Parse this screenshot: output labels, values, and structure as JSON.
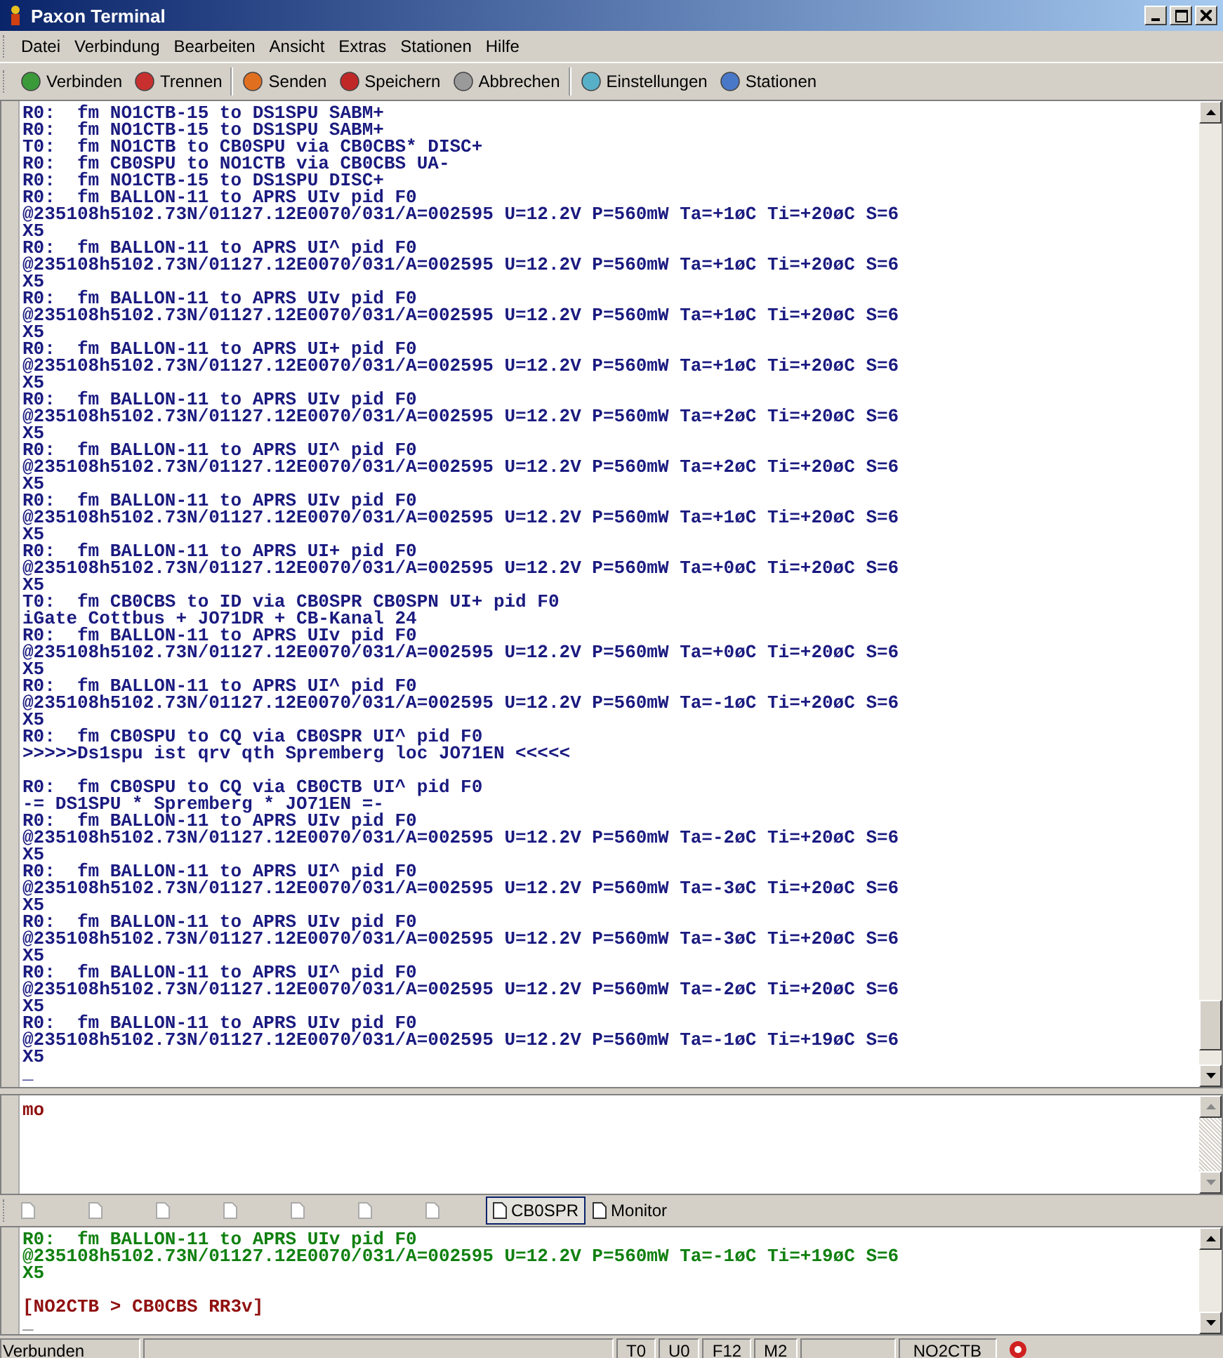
{
  "window": {
    "title": "Paxon Terminal"
  },
  "menu": [
    "Datei",
    "Verbindung",
    "Bearbeiten",
    "Ansicht",
    "Extras",
    "Stationen",
    "Hilfe"
  ],
  "toolbar": [
    {
      "label": "Verbinden",
      "kind": "connect",
      "group_start": false
    },
    {
      "label": "Trennen",
      "kind": "disconnect",
      "group_start": false
    },
    {
      "label": "Senden",
      "kind": "send",
      "group_start": true
    },
    {
      "label": "Speichern",
      "kind": "save",
      "group_start": false
    },
    {
      "label": "Abbrechen",
      "kind": "cancel",
      "group_start": false
    },
    {
      "label": "Einstellungen",
      "kind": "settings",
      "group_start": true
    },
    {
      "label": "Stationen",
      "kind": "stations",
      "group_start": false
    }
  ],
  "monitor": {
    "lines": [
      {
        "kind": "rx",
        "text": "R0:  fm NO1CTB-15 to DS1SPU SABM+"
      },
      {
        "kind": "rx",
        "text": "R0:  fm NO1CTB-15 to DS1SPU SABM+"
      },
      {
        "kind": "rx",
        "text": "T0:  fm NO1CTB to CB0SPU via CB0CBS* DISC+"
      },
      {
        "kind": "rx",
        "text": "R0:  fm CB0SPU to NO1CTB via CB0CBS UA-"
      },
      {
        "kind": "rx",
        "text": "R0:  fm NO1CTB-15 to DS1SPU DISC+"
      },
      {
        "kind": "rx",
        "text": "R0:  fm BALLON-11 to APRS UIv pid F0"
      },
      {
        "kind": "rx",
        "text": "@235108h5102.73N/01127.12E0070/031/A=002595 U=12.2V P=560mW Ta=+1øC Ti=+20øC S=6"
      },
      {
        "kind": "rx",
        "text": "X5"
      },
      {
        "kind": "rx",
        "text": "R0:  fm BALLON-11 to APRS UI^ pid F0"
      },
      {
        "kind": "rx",
        "text": "@235108h5102.73N/01127.12E0070/031/A=002595 U=12.2V P=560mW Ta=+1øC Ti=+20øC S=6"
      },
      {
        "kind": "rx",
        "text": "X5"
      },
      {
        "kind": "rx",
        "text": "R0:  fm BALLON-11 to APRS UIv pid F0"
      },
      {
        "kind": "rx",
        "text": "@235108h5102.73N/01127.12E0070/031/A=002595 U=12.2V P=560mW Ta=+1øC Ti=+20øC S=6"
      },
      {
        "kind": "rx",
        "text": "X5"
      },
      {
        "kind": "rx",
        "text": "R0:  fm BALLON-11 to APRS UI+ pid F0"
      },
      {
        "kind": "rx",
        "text": "@235108h5102.73N/01127.12E0070/031/A=002595 U=12.2V P=560mW Ta=+1øC Ti=+20øC S=6"
      },
      {
        "kind": "rx",
        "text": "X5"
      },
      {
        "kind": "rx",
        "text": "R0:  fm BALLON-11 to APRS UIv pid F0"
      },
      {
        "kind": "rx",
        "text": "@235108h5102.73N/01127.12E0070/031/A=002595 U=12.2V P=560mW Ta=+2øC Ti=+20øC S=6"
      },
      {
        "kind": "rx",
        "text": "X5"
      },
      {
        "kind": "rx",
        "text": "R0:  fm BALLON-11 to APRS UI^ pid F0"
      },
      {
        "kind": "rx",
        "text": "@235108h5102.73N/01127.12E0070/031/A=002595 U=12.2V P=560mW Ta=+2øC Ti=+20øC S=6"
      },
      {
        "kind": "rx",
        "text": "X5"
      },
      {
        "kind": "rx",
        "text": "R0:  fm BALLON-11 to APRS UIv pid F0"
      },
      {
        "kind": "rx",
        "text": "@235108h5102.73N/01127.12E0070/031/A=002595 U=12.2V P=560mW Ta=+1øC Ti=+20øC S=6"
      },
      {
        "kind": "rx",
        "text": "X5"
      },
      {
        "kind": "rx",
        "text": "R0:  fm BALLON-11 to APRS UI+ pid F0"
      },
      {
        "kind": "rx",
        "text": "@235108h5102.73N/01127.12E0070/031/A=002595 U=12.2V P=560mW Ta=+0øC Ti=+20øC S=6"
      },
      {
        "kind": "rx",
        "text": "X5"
      },
      {
        "kind": "rx",
        "text": "T0:  fm CB0CBS to ID via CB0SPR CB0SPN UI+ pid F0"
      },
      {
        "kind": "rx",
        "text": "iGate Cottbus + JO71DR + CB-Kanal 24"
      },
      {
        "kind": "rx",
        "text": "R0:  fm BALLON-11 to APRS UIv pid F0"
      },
      {
        "kind": "rx",
        "text": "@235108h5102.73N/01127.12E0070/031/A=002595 U=12.2V P=560mW Ta=+0øC Ti=+20øC S=6"
      },
      {
        "kind": "rx",
        "text": "X5"
      },
      {
        "kind": "rx",
        "text": "R0:  fm BALLON-11 to APRS UI^ pid F0"
      },
      {
        "kind": "rx",
        "text": "@235108h5102.73N/01127.12E0070/031/A=002595 U=12.2V P=560mW Ta=-1øC Ti=+20øC S=6"
      },
      {
        "kind": "rx",
        "text": "X5"
      },
      {
        "kind": "rx",
        "text": "R0:  fm CB0SPU to CQ via CB0SPR UI^ pid F0"
      },
      {
        "kind": "rx",
        "text": ">>>>>Ds1spu ist qrv qth Spremberg loc JO71EN <<<<<"
      },
      {
        "kind": "blank"
      },
      {
        "kind": "rx",
        "text": "R0:  fm CB0SPU to CQ via CB0CTB UI^ pid F0"
      },
      {
        "kind": "rx",
        "text": "-= DS1SPU * Spremberg * JO71EN =-"
      },
      {
        "kind": "rx",
        "text": "R0:  fm BALLON-11 to APRS UIv pid F0"
      },
      {
        "kind": "rx",
        "text": "@235108h5102.73N/01127.12E0070/031/A=002595 U=12.2V P=560mW Ta=-2øC Ti=+20øC S=6"
      },
      {
        "kind": "rx",
        "text": "X5"
      },
      {
        "kind": "rx",
        "text": "R0:  fm BALLON-11 to APRS UI^ pid F0"
      },
      {
        "kind": "rx",
        "text": "@235108h5102.73N/01127.12E0070/031/A=002595 U=12.2V P=560mW Ta=-3øC Ti=+20øC S=6"
      },
      {
        "kind": "rx",
        "text": "X5"
      },
      {
        "kind": "rx",
        "text": "R0:  fm BALLON-11 to APRS UIv pid F0"
      },
      {
        "kind": "rx",
        "text": "@235108h5102.73N/01127.12E0070/031/A=002595 U=12.2V P=560mW Ta=-3øC Ti=+20øC S=6"
      },
      {
        "kind": "rx",
        "text": "X5"
      },
      {
        "kind": "rx",
        "text": "R0:  fm BALLON-11 to APRS UI^ pid F0"
      },
      {
        "kind": "rx",
        "text": "@235108h5102.73N/01127.12E0070/031/A=002595 U=12.2V P=560mW Ta=-2øC Ti=+20øC S=6"
      },
      {
        "kind": "rx",
        "text": "X5"
      },
      {
        "kind": "rx",
        "text": "R0:  fm BALLON-11 to APRS UIv pid F0"
      },
      {
        "kind": "rx",
        "text": "@235108h5102.73N/01127.12E0070/031/A=002595 U=12.2V P=560mW Ta=-1øC Ti=+19øC S=6"
      },
      {
        "kind": "rx",
        "text": "X5"
      },
      {
        "kind": "cursor",
        "text": "_"
      }
    ]
  },
  "input": {
    "value": "mo"
  },
  "tabs": [
    {
      "selected": false
    },
    {
      "selected": false
    },
    {
      "selected": false
    },
    {
      "selected": false
    },
    {
      "selected": false
    },
    {
      "selected": false
    },
    {
      "selected": false
    },
    {
      "label": "CB0SPR",
      "selected": true
    },
    {
      "label": "Monitor",
      "selected": false
    }
  ],
  "session": {
    "lines": [
      {
        "kind": "rx",
        "text": "R0:  fm BALLON-11 to APRS UIv pid F0"
      },
      {
        "kind": "rx",
        "text": "@235108h5102.73N/01127.12E0070/031/A=002595 U=12.2V P=560mW Ta=-1øC Ti=+19øC S=6"
      },
      {
        "kind": "rx",
        "text": "X5"
      },
      {
        "kind": "blank"
      },
      {
        "kind": "tx",
        "text": "[NO2CTB > CB0CBS RR3v]"
      },
      {
        "kind": "cursor",
        "text": "_"
      }
    ]
  },
  "status_bar": {
    "connection": "Verbunden",
    "fields": [
      "T0",
      "U0",
      "F12",
      "M2"
    ],
    "callsign": "NO2CTB"
  }
}
